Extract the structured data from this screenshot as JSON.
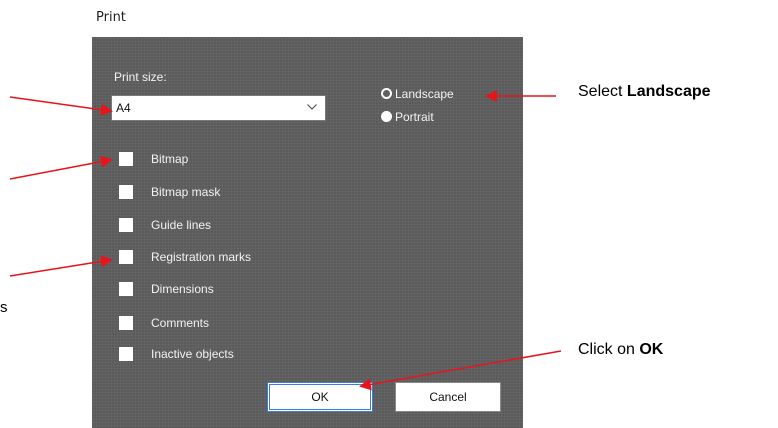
{
  "dialog": {
    "title": "Print",
    "print_size_label": "Print size:",
    "print_size_value": "A4",
    "orientation": [
      {
        "label": "Landscape",
        "selected": true
      },
      {
        "label": "Portrait",
        "selected": false
      }
    ],
    "options": [
      {
        "label": "Bitmap",
        "checked": false
      },
      {
        "label": "Bitmap mask",
        "checked": false
      },
      {
        "label": "Guide lines",
        "checked": false
      },
      {
        "label": "Registration marks",
        "checked": false
      },
      {
        "label": "Dimensions",
        "checked": false
      },
      {
        "label": "Comments",
        "checked": false
      },
      {
        "label": "Inactive objects",
        "checked": false
      }
    ],
    "ok_label": "OK",
    "cancel_label": "Cancel"
  },
  "annotations": {
    "landscape_prefix": "Select ",
    "landscape_bold": "Landscape",
    "ok_prefix": "Click on ",
    "ok_bold": "OK",
    "cut_fragment": "s"
  },
  "colors": {
    "dialog_background": "#5b5b5b",
    "arrow": "#e8141c",
    "ok_focus": "#3c7fd1"
  },
  "icons": {
    "dropdown": "chevron-down-icon",
    "arrow": "red-arrow-icon"
  }
}
